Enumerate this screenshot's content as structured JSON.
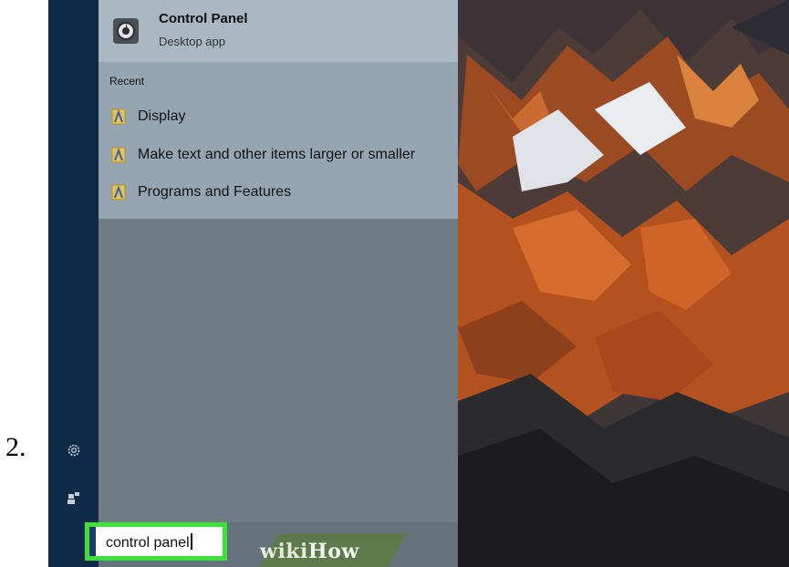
{
  "step": {
    "number": "2."
  },
  "best_match": {
    "title": "Control Panel",
    "subtitle": "Desktop app",
    "icon": "control-panel-icon"
  },
  "recent": {
    "label": "Recent",
    "items": [
      {
        "label": "Display",
        "icon": "settings-shortcut-icon"
      },
      {
        "label": "Make text and other items larger or smaller",
        "icon": "settings-shortcut-icon"
      },
      {
        "label": "Programs and Features",
        "icon": "settings-shortcut-icon"
      }
    ]
  },
  "rail": {
    "icons": [
      "gear-icon",
      "user-icon"
    ]
  },
  "search": {
    "value": "control panel",
    "highlight_color": "#3ee03a"
  },
  "watermark": {
    "part1": "wiki",
    "part2": "How"
  },
  "colors": {
    "rail": "#0e2a47",
    "panel": "#6f7c86",
    "results": "#95a5b2",
    "best_match": "#aab8c3"
  }
}
